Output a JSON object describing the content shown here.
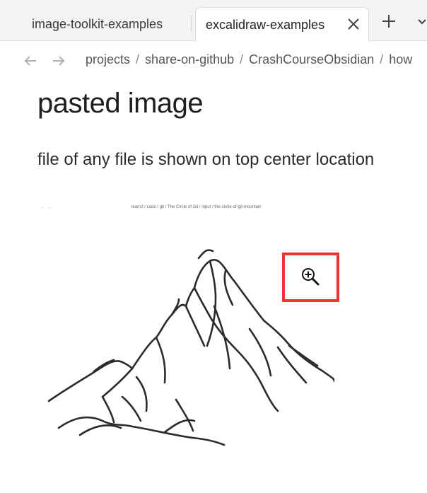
{
  "tabs": [
    {
      "label": "image-toolkit-examples",
      "active": false
    },
    {
      "label": "excalidraw-examples",
      "active": true
    }
  ],
  "breadcrumb": [
    "projects",
    "share-on-github",
    "CrashCourseObsidian",
    "how"
  ],
  "breadcrumb_separator": "/",
  "page": {
    "title": "pasted image",
    "paragraph": "file of any file is shown on top center location"
  },
  "embedded_image": {
    "nav_arrows": "← →",
    "breadcrumb": "learn2  /  code  /  git  /  The Circle of Git  /  input  /  the-circle-of-git-mountain"
  },
  "colors": {
    "highlight": "#ee3333",
    "tabbar": "#f3f3f3"
  },
  "icons": [
    "close-icon",
    "plus-icon",
    "chevron-down-icon",
    "arrow-left-icon",
    "arrow-right-icon",
    "zoom-in-cursor-icon"
  ]
}
